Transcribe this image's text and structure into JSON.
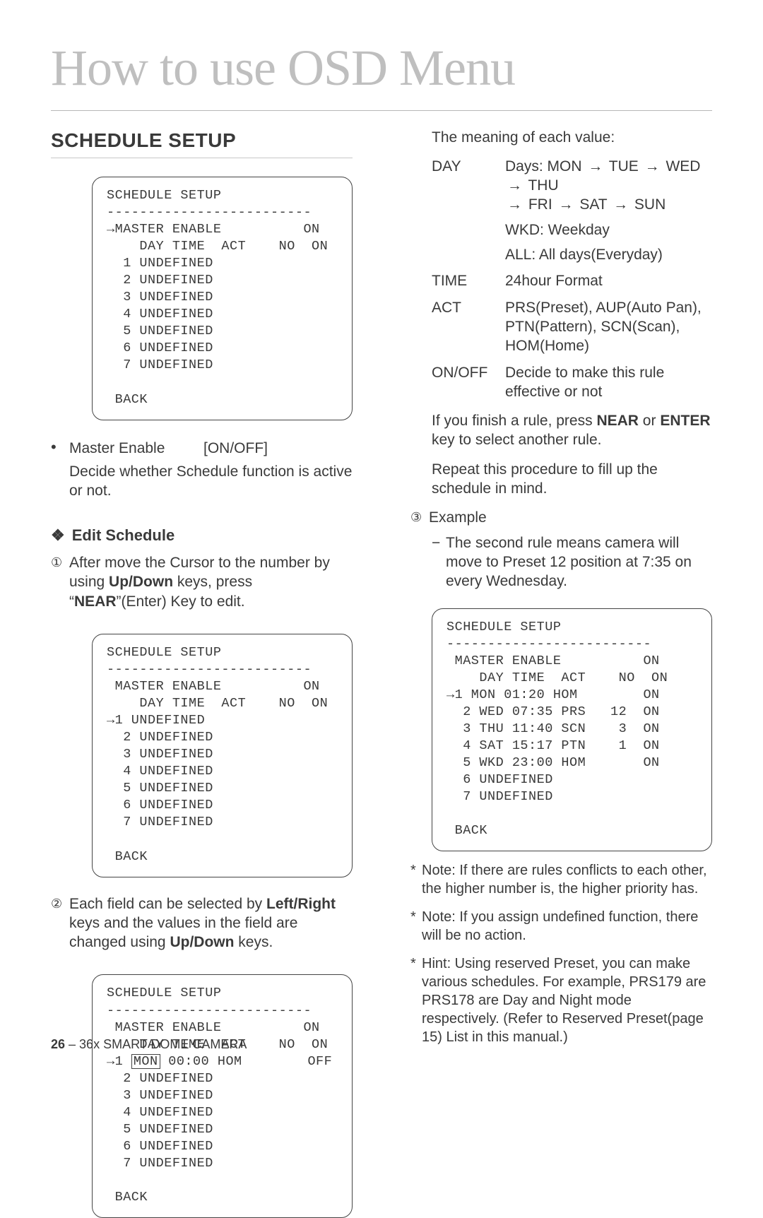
{
  "page": {
    "title": "How to use OSD Menu",
    "section": "SCHEDULE SETUP",
    "footer_page": "26",
    "footer_text": " – 36x SMART DOME CAMERA"
  },
  "osd1": {
    "l1": "SCHEDULE SETUP",
    "l2": "-------------------------",
    "l3": "→MASTER ENABLE          ON",
    "l4": "    DAY TIME  ACT    NO  ON",
    "l5": "  1 UNDEFINED",
    "l6": "  2 UNDEFINED",
    "l7": "  3 UNDEFINED",
    "l8": "  4 UNDEFINED",
    "l9": "  5 UNDEFINED",
    "l10": "  6 UNDEFINED",
    "l11": "  7 UNDEFINED",
    "l12": " BACK"
  },
  "left": {
    "bullet_label": "Master Enable",
    "bullet_val": "[ON/OFF]",
    "bullet_desc": "Decide whether Schedule function is active or not.",
    "subhead": "Edit Schedule",
    "step1_a": "After move the Cursor to the number by using ",
    "step1_b": "Up/Down",
    "step1_c": " keys, press “",
    "step1_d": "NEAR",
    "step1_e": "”(Enter) Key to edit.",
    "step2_a": "Each field can be selected by ",
    "step2_b": "Left/Right",
    "step2_c": " keys and the values in the field are changed using ",
    "step2_d": "Up/Down",
    "step2_e": " keys.",
    "circled1": "①",
    "circled2": "②",
    "circled3": "③"
  },
  "osd2": {
    "l1": "SCHEDULE SETUP",
    "l2": "-------------------------",
    "l3": " MASTER ENABLE          ON",
    "l4": "    DAY TIME  ACT    NO  ON",
    "l5": "→1 UNDEFINED",
    "l6": "  2 UNDEFINED",
    "l7": "  3 UNDEFINED",
    "l8": "  4 UNDEFINED",
    "l9": "  5 UNDEFINED",
    "l10": "  6 UNDEFINED",
    "l11": "  7 UNDEFINED",
    "l12": " BACK"
  },
  "osd3": {
    "l1": "SCHEDULE SETUP",
    "l2": "-------------------------",
    "l3": " MASTER ENABLE          ON",
    "l4": "    DAY TIME  ACT    NO  ON",
    "l5a": "→1 ",
    "l5b": "MON",
    "l5c": " 00:00 HOM        OFF",
    "l6": "  2 UNDEFINED",
    "l7": "  3 UNDEFINED",
    "l8": "  4 UNDEFINED",
    "l9": "  5 UNDEFINED",
    "l10": "  6 UNDEFINED",
    "l11": "  7 UNDEFINED",
    "l12": " BACK"
  },
  "right": {
    "intro": "The meaning of each value:",
    "day_dt": "DAY",
    "day_line1_a": "Days: MON ",
    "day_line1_b": " TUE ",
    "day_line1_c": " WED ",
    "day_line1_d": " THU ",
    "day_line2_a": " FRI ",
    "day_line2_b": " SAT ",
    "day_line2_c": " SUN",
    "day_wkd": "WKD: Weekday",
    "day_all": "ALL: All days(Everyday)",
    "time_dt": "TIME",
    "time_dd": "24hour Format",
    "act_dt": "ACT",
    "act_dd": "PRS(Preset), AUP(Auto Pan), PTN(Pattern), SCN(Scan), HOM(Home)",
    "onoff_dt": "ON/OFF",
    "onoff_dd": "Decide to make this rule effective or not",
    "finish_a": "If you finish a rule, press ",
    "finish_b": "NEAR",
    "finish_c": " or ",
    "finish_d": "ENTER",
    "finish_e": " key to select another rule.",
    "repeat": "Repeat this procedure to fill up the schedule in mind.",
    "example_label": "Example",
    "example_dash": "The second rule means camera will move to Preset 12 position at 7:35 on every Wednesday.",
    "arrow": "→"
  },
  "osd4": {
    "l1": "SCHEDULE SETUP",
    "l2": "-------------------------",
    "l3": " MASTER ENABLE          ON",
    "l4": "    DAY TIME  ACT    NO  ON",
    "l5": "→1 MON 01:20 HOM        ON",
    "l6": "  2 WED 07:35 PRS   12  ON",
    "l7": "  3 THU 11:40 SCN    3  ON",
    "l8": "  4 SAT 15:17 PTN    1  ON",
    "l9": "  5 WKD 23:00 HOM       ON",
    "l10": "  6 UNDEFINED",
    "l11": "  7 UNDEFINED",
    "l12": " BACK"
  },
  "notes": {
    "n1": "Note: If there are rules conflicts to each other, the higher number is, the higher priority has.",
    "n2": "Note: If you assign undefined function, there will be no action.",
    "n3": "Hint: Using reserved Preset, you can make various schedules. For example, PRS179 are PRS178 are Day and Night mode respectively. (Refer to Reserved Preset(page 15) List in this manual.)"
  }
}
